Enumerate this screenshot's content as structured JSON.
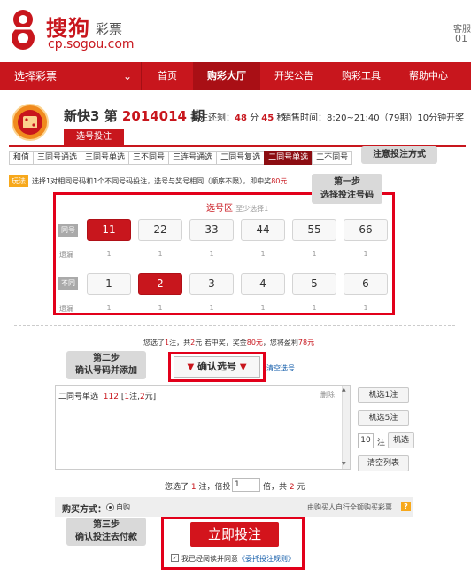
{
  "header": {
    "brand_name": "搜狗",
    "brand_product": "彩票",
    "brand_url": "cp.sogou.com",
    "corner_label": "客服",
    "corner_value": "01"
  },
  "nav": {
    "select_label": "选择彩票",
    "items": [
      {
        "label": "首页"
      },
      {
        "label": "购彩大厅"
      },
      {
        "label": "开奖公告"
      },
      {
        "label": "购彩工具"
      },
      {
        "label": "帮助中心"
      }
    ],
    "active_index": 1
  },
  "game": {
    "name": "新快3 第",
    "issue": "2014014",
    "issue_suffix": "期",
    "countdown_label": "投注还剩：",
    "countdown_min": "48",
    "min_unit": "分",
    "countdown_sec": "45",
    "sec_unit": "秒",
    "sale_time": "销售时间：8:20~21:40（79期）10分钟开奖",
    "tab_label": "选号投注"
  },
  "subtabs": [
    "和值",
    "三同号通选",
    "三同号单选",
    "三不同号",
    "三连号通选",
    "二同号复选",
    "二同号单选",
    "二不同号"
  ],
  "subtab_active": 6,
  "tips": {
    "method": "注意投注方式",
    "step1_line1": "第一步",
    "step1_line2": "选择投注号码",
    "step2_line1": "第二步",
    "step2_line2": "确认号码并添加",
    "step3_line1": "第三步",
    "step3_line2": "确认投注去付款"
  },
  "rule": {
    "tag": "玩法",
    "text": "选择1对相同号码和1个不同号码投注，选号与奖号相同（顺序不限），即中奖",
    "prize": "80元"
  },
  "select_area": {
    "title": "选号区",
    "hint": "至少选择1",
    "row1_label": "同号",
    "row2_label": "不同号",
    "miss_label": "遗漏",
    "row1": [
      {
        "num": "11",
        "miss": "1"
      },
      {
        "num": "22",
        "miss": "1"
      },
      {
        "num": "33",
        "miss": "1"
      },
      {
        "num": "44",
        "miss": "1"
      },
      {
        "num": "55",
        "miss": "1"
      },
      {
        "num": "66",
        "miss": "1"
      }
    ],
    "row1_selected": 0,
    "row2": [
      {
        "num": "1",
        "miss": "1"
      },
      {
        "num": "2",
        "miss": "1"
      },
      {
        "num": "3",
        "miss": "1"
      },
      {
        "num": "4",
        "miss": "1"
      },
      {
        "num": "5",
        "miss": "1"
      },
      {
        "num": "6",
        "miss": "1"
      }
    ],
    "row2_selected": 1
  },
  "summary1": {
    "p1": "您选了",
    "count": "1",
    "p2": "注，共",
    "amount": "2",
    "p3": "元 若中奖，奖金",
    "prize": "80元",
    "p4": "，您将盈利",
    "profit": "78元"
  },
  "confirm": {
    "label": "确认选号",
    "clear": "清空选号"
  },
  "list": {
    "item_type": "二同号单选",
    "item_num": "112",
    "item_detail_a": "[",
    "item_count": "1",
    "item_detail_b": "注,",
    "item_amount": "2",
    "item_detail_c": "元]",
    "delete": "删除"
  },
  "side": {
    "random1": "机选1注",
    "random5": "机选5注",
    "qty": "10",
    "qty_unit": "注",
    "random_n": "机选",
    "clear_list": "清空列表"
  },
  "summary2": {
    "p1": "您选了",
    "count": "1",
    "p2": "注，倍投",
    "multiple": "1",
    "p3": "倍，共",
    "amount": "2",
    "p4": "元"
  },
  "buy": {
    "label": "购买方式：",
    "option": "自购",
    "desc": "由购买人自行全额购买彩票",
    "help": "?"
  },
  "submit": {
    "label": "立即投注",
    "agree_prefix": "我已经阅读并同意",
    "agree_link": "《委托投注规则》"
  },
  "colors": {
    "brand_red": "#c8161d",
    "link_blue": "#0f5aa8",
    "tip_orange": "#f7a81b"
  }
}
